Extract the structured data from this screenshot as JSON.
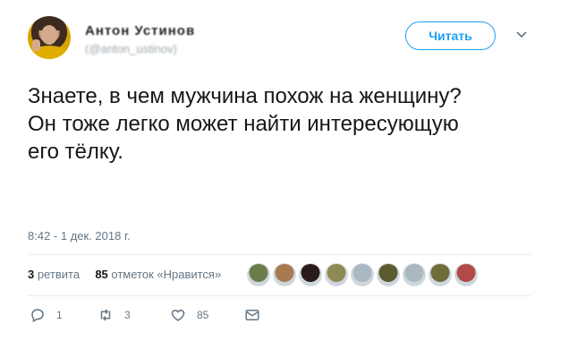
{
  "author": {
    "display_name": "Антон Устинов",
    "handle": "(@anton_ustinov)"
  },
  "follow_button": {
    "label": "Читать"
  },
  "tweet": {
    "lines": [
      "Знаете, в чем мужчина похож на женщину?",
      "Он тоже легко может найти интересующую",
      "его тёлку."
    ],
    "timestamp": "8:42 - 1 дек. 2018 г."
  },
  "stats": {
    "retweets_count": "3",
    "retweets_label": "ретвита",
    "likes_count": "85",
    "likes_label": "отметок «Нравится»"
  },
  "likers": [
    {
      "icon": "liker-avatar",
      "color": "#6b7d4b"
    },
    {
      "icon": "liker-avatar",
      "color": "#a87a50"
    },
    {
      "icon": "liker-avatar",
      "color": "#2a1b1b"
    },
    {
      "icon": "liker-avatar",
      "color": "#8f8a55"
    },
    {
      "icon": "liker-avatar",
      "color": "#aab8c2"
    },
    {
      "icon": "liker-avatar",
      "color": "#5c5a2f"
    },
    {
      "icon": "liker-avatar",
      "color": "#aab8c2"
    },
    {
      "icon": "liker-avatar",
      "color": "#6e6e3a"
    },
    {
      "icon": "liker-avatar",
      "color": "#b24a4a"
    }
  ],
  "actions": {
    "reply_count": "1",
    "retweet_count": "3",
    "like_count": "85"
  },
  "colors": {
    "accent": "#1da1f2",
    "secondary_text": "#657786",
    "divider": "#e6ecf0"
  }
}
